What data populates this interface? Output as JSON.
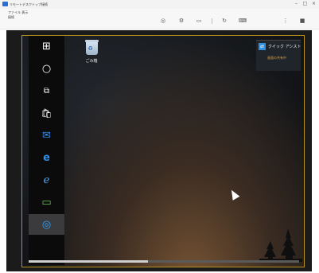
{
  "window": {
    "title": "リモートデスクトップ接続",
    "controls": {
      "minimize": "–",
      "maximize": "□",
      "close": "×"
    }
  },
  "toolbar": {
    "line1": "ファイル 表示",
    "line2": "接続",
    "icons": [
      "circle-icon",
      "settings-icon",
      "monitor-icon",
      "refresh-icon",
      "keyboard-icon",
      "more-icon",
      "fullscreen-icon"
    ]
  },
  "taskbar": {
    "items": [
      {
        "name": "start",
        "glyph": "⊞",
        "active": false
      },
      {
        "name": "search",
        "glyph": "○",
        "active": false
      },
      {
        "name": "task-view",
        "glyph": "⧉",
        "active": false
      },
      {
        "name": "store",
        "glyph": "🛍",
        "active": false
      },
      {
        "name": "outlook",
        "glyph": "✉",
        "active": false
      },
      {
        "name": "edge",
        "glyph": "e",
        "active": false
      },
      {
        "name": "ie",
        "glyph": "ℯ",
        "active": false
      },
      {
        "name": "app",
        "glyph": "▭",
        "active": false
      },
      {
        "name": "remote",
        "glyph": "◎",
        "active": true
      }
    ]
  },
  "desktop": {
    "icons": [
      {
        "label": "ごみ箱"
      }
    ],
    "notification": {
      "title": "クイック アシスト",
      "subtitle": "画面の共有中"
    }
  }
}
